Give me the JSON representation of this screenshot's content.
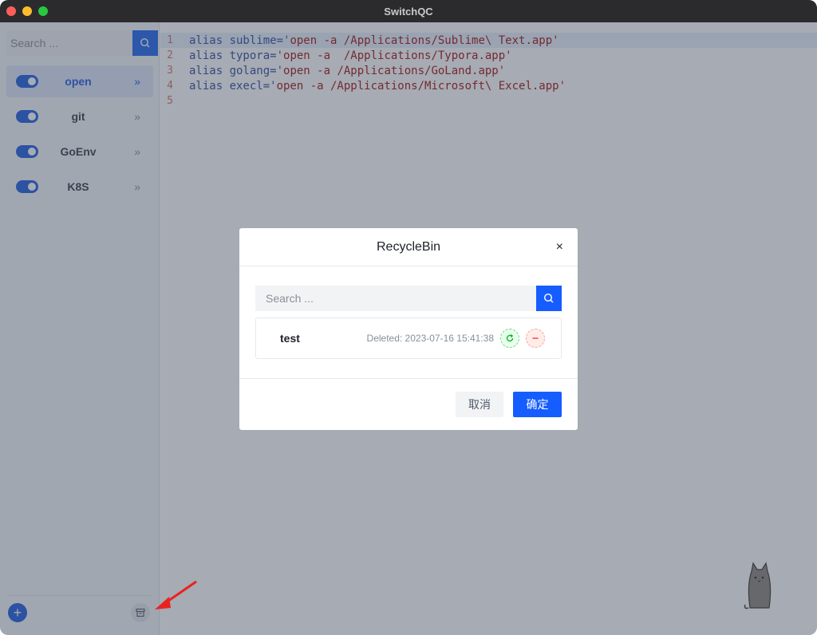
{
  "window": {
    "title": "SwitchQC"
  },
  "sidebar": {
    "search_placeholder": "Search ...",
    "items": [
      {
        "label": "open",
        "enabled": true,
        "active": true
      },
      {
        "label": "git",
        "enabled": true,
        "active": false
      },
      {
        "label": "GoEnv",
        "enabled": true,
        "active": false
      },
      {
        "label": "K8S",
        "enabled": true,
        "active": false
      }
    ],
    "chevron": "»",
    "add_label": "+"
  },
  "editor": {
    "lines": [
      {
        "num": "1",
        "text": "alias sublime='open -a /Applications/Sublime\\ Text.app'"
      },
      {
        "num": "2",
        "text": "alias typora='open -a  /Applications/Typora.app'"
      },
      {
        "num": "3",
        "text": "alias golang='open -a /Applications/GoLand.app'"
      },
      {
        "num": "4",
        "text": "alias execl='open -a /Applications/Microsoft\\ Excel.app'"
      },
      {
        "num": "5",
        "text": ""
      }
    ]
  },
  "modal": {
    "title": "RecycleBin",
    "close": "×",
    "search_placeholder": "Search ...",
    "items": [
      {
        "name": "test",
        "deleted": "Deleted: 2023-07-16 15:41:38"
      }
    ],
    "cancel_label": "取消",
    "ok_label": "确定"
  },
  "colors": {
    "accent": "#165dff",
    "restore": "#00b42a",
    "delete": "#f53f3f",
    "overlay": "#3c4456"
  }
}
